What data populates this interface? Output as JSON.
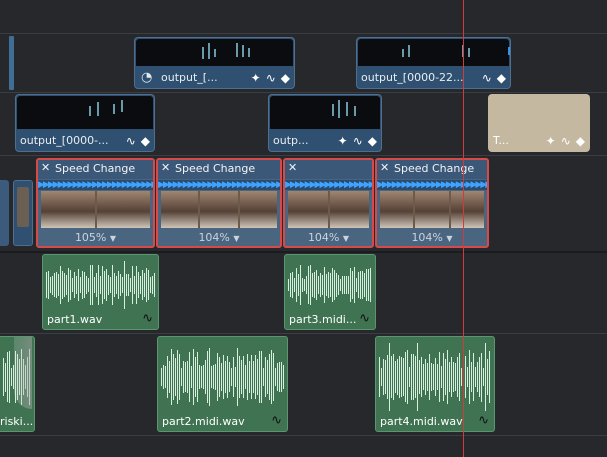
{
  "video_track_2": [
    {
      "label": "output_[...",
      "icons": [
        "speed-icon",
        "sparkle-icon",
        "curve-icon",
        "keyframe-icon"
      ]
    },
    {
      "label": "output_[0000-22...",
      "icons": [
        "curve-icon",
        "keyframe-icon"
      ]
    }
  ],
  "video_track_1": [
    {
      "label": "output_[0000-...",
      "icons": [
        "curve-icon",
        "keyframe-icon"
      ]
    },
    {
      "label": "outp...",
      "icons": [
        "sparkle-icon",
        "curve-icon",
        "keyframe-icon"
      ]
    },
    {
      "label": "T...",
      "icons": [
        "sparkle-icon",
        "curve-icon",
        "keyframe-icon"
      ]
    }
  ],
  "speed_clips": [
    {
      "title": "Speed Change",
      "speed": "105%"
    },
    {
      "title": "Speed Change",
      "speed": "104%"
    },
    {
      "title": "",
      "speed": "104%"
    },
    {
      "title": "Speed Change",
      "speed": "104%"
    }
  ],
  "audio_track_1": [
    {
      "label": "part1.wav"
    },
    {
      "label": "part3.midi..."
    }
  ],
  "audio_track_2": [
    {
      "label": "riski..."
    },
    {
      "label": "part2.midi.wav"
    },
    {
      "label": "part4.midi.wav"
    }
  ],
  "glyphs": {
    "close": "✕",
    "dropdown": "▼",
    "curve": "∿",
    "keyframe": "◆",
    "sparkle": "✦",
    "speed": "◔"
  },
  "colors": {
    "selection": "#d74a4a",
    "playhead": "#d13b3b",
    "video": "#2f5070",
    "audio": "#3f7352"
  }
}
